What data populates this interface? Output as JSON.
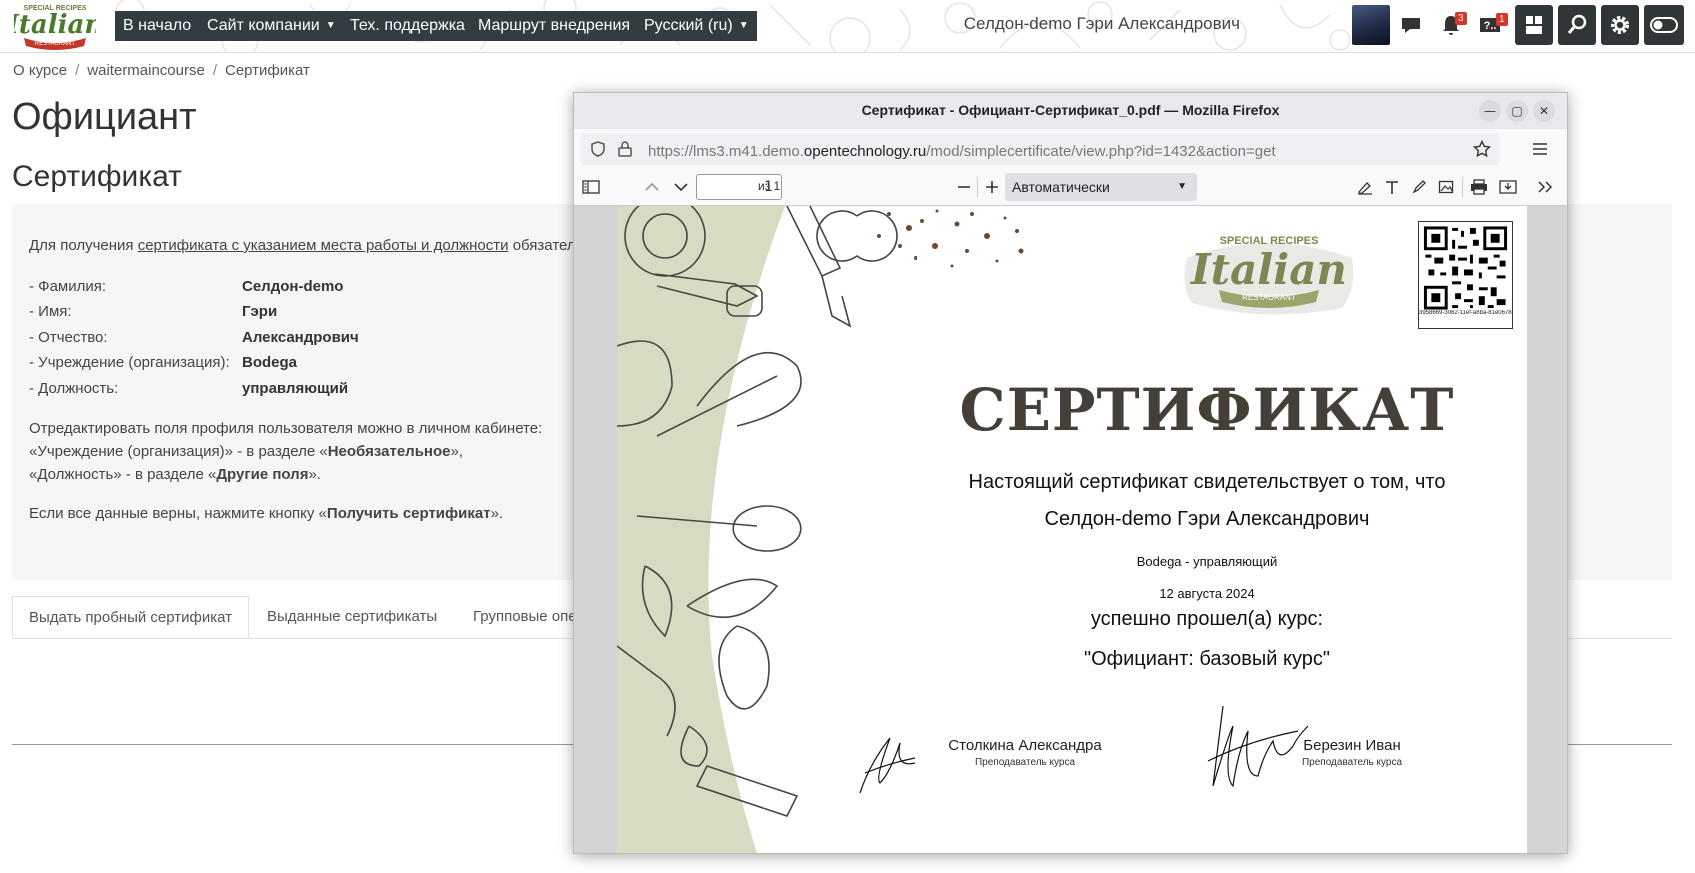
{
  "navbar": {
    "buttons": [
      {
        "label": "В начало",
        "dropdown": false
      },
      {
        "label": "Сайт компании",
        "dropdown": true
      },
      {
        "label": "Тех. поддержка",
        "dropdown": false
      },
      {
        "label": "Маршрут внедрения",
        "dropdown": false
      },
      {
        "label": "Русский (ru)",
        "dropdown": true
      }
    ],
    "user_name": "Селдон-demo Гэри Александрович",
    "notifications_count": "3",
    "help_count": "1",
    "logo": {
      "top": "SPECIAL RECIPES",
      "main": "Italian",
      "bottom": "RESTAURANT"
    }
  },
  "breadcrumb": [
    "О курсе",
    "waitermaincourse",
    "Сертификат"
  ],
  "page": {
    "title": "Официант",
    "subtitle": "Сертификат",
    "intro_prefix": "Для получения ",
    "intro_link": "сертификата с указанием места работы и должности",
    "intro_suffix": " обязател",
    "fields": [
      {
        "label": "- Фамилия:",
        "value": "Селдон-demo"
      },
      {
        "label": "- Имя:",
        "value": "Гэри"
      },
      {
        "label": "- Отчество:",
        "value": "Александрович"
      },
      {
        "label": "- Учреждение (организация):",
        "value": "Bodega"
      },
      {
        "label": "- Должность:",
        "value": "управляющий"
      }
    ],
    "edit_line1": "Отредактировать поля профиля пользователя можно в личном кабинете:",
    "edit_line2_prefix": "«Учреждение (организация)» - в разделе «",
    "edit_line2_bold": "Необязательное",
    "edit_line2_suffix": "»,",
    "edit_line3_prefix": "«Должность» - в разделе «",
    "edit_line3_bold": "Другие поля",
    "edit_line3_suffix": "».",
    "confirm_prefix": "Если все данные верны, нажмите кнопку «",
    "confirm_bold": "Получить сертификат",
    "confirm_suffix": "»."
  },
  "tabs": [
    "Выдать пробный сертификат",
    "Выданные сертификаты",
    "Групповые опе"
  ],
  "firefox": {
    "title": "Сертификат - Официант-Сертификат_0.pdf — Mozilla Firefox",
    "url_prefix": "https://lms3.m41.demo.",
    "url_domain": "opentechnology.ru",
    "url_suffix": "/mod/simplecertificate/view.php?id=1432&action=get",
    "page_number": "1",
    "page_count": "из 1",
    "zoom": "Автоматически"
  },
  "certificate": {
    "heading": "СЕРТИФИКАТ",
    "line1": "Настоящий сертификат свидетельствует о том, что",
    "name": "Селдон-demo Гэри Александрович",
    "org": "Bodega - управляющий",
    "date": "12 августа 2024",
    "passed": "успешно прошел(а) курс:",
    "course": "\"Официант: базовый курс\"",
    "qr_code": "3958669-3062-11ef-a8ba-81e0678659e",
    "logo": {
      "top": "SPECIAL RECIPES",
      "main": "Italian",
      "bottom": "RESTAURANT"
    },
    "signers": [
      {
        "name": "Столкина Александра",
        "role": "Преподаватель курса"
      },
      {
        "name": "Березин Иван",
        "role": "Преподаватель курса"
      }
    ]
  },
  "colors": {
    "navbar_button": "#333c40",
    "cert_green": "#d5dcc2",
    "cert_title": "#444038",
    "badge": "#d9362b"
  }
}
